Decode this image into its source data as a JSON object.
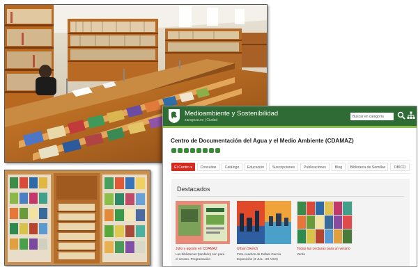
{
  "site": {
    "header_title": "Medioambiente y Sostenibilidad",
    "header_domain": "zaragoza.es | Ciudad",
    "search_placeholder": "Buscar en categoría",
    "page_title": "Centro de Documentación del Agua y el Medio Ambiente (CDAMAZ)",
    "social_icons": [
      "social-icon-1",
      "social-icon-2",
      "social-icon-3",
      "social-icon-4",
      "social-icon-5",
      "social-icon-6",
      "social-icon-7",
      "social-icon-8"
    ],
    "nav": [
      "El Centro",
      "Consultas",
      "Catálogo",
      "Educación",
      "Suscripciones",
      "Publicaciones",
      "Blog",
      "Biblioteca de Semillas",
      "OBICO"
    ],
    "nav_active_marker": "▾",
    "section_title": "Destacados",
    "cards": [
      {
        "title": "Julio y agosto en CDAMAZ",
        "desc": [
          "Las bibliotecas (también) son para",
          "el verano. Programación"
        ]
      },
      {
        "title": "Urban Sketch",
        "desc": [
          "Foto-cuadros de Rafael García",
          "Exposición (3 JUL - 29 AGO)"
        ]
      },
      {
        "title": "Todas las Lecturas para un verano",
        "desc": [
          "Verde"
        ]
      }
    ]
  },
  "colors": {
    "header_green": "#2f6b35",
    "accent_red": "#d42b20",
    "lime": "#8cbf4f"
  }
}
